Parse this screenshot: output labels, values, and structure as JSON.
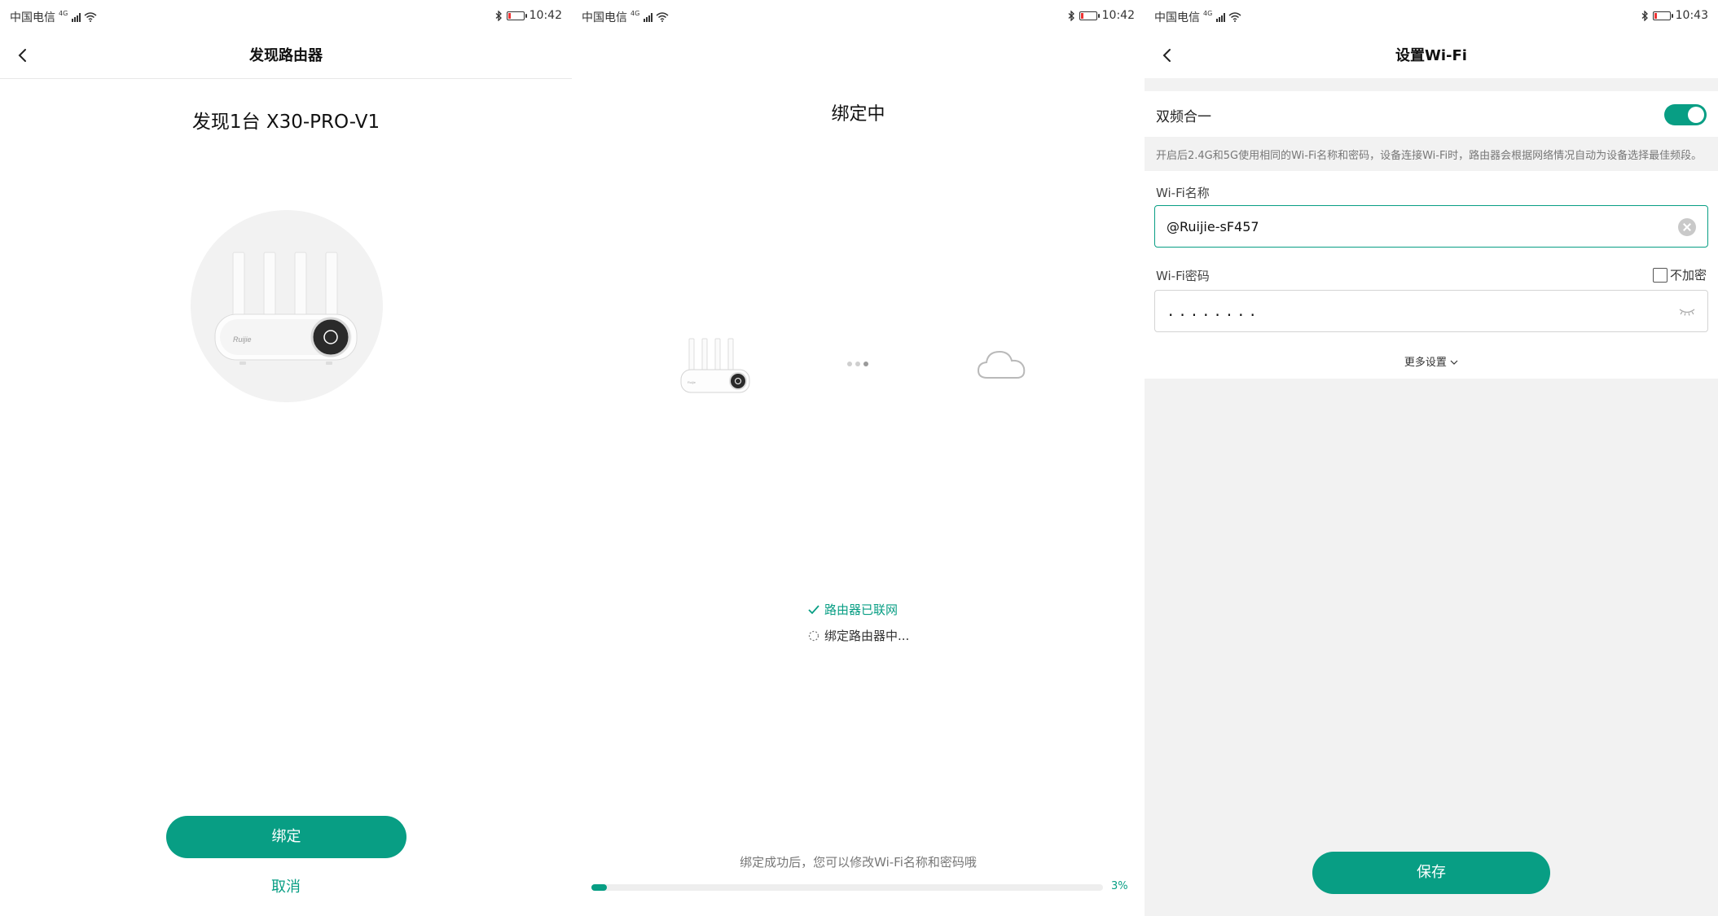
{
  "panels": [
    {
      "status": {
        "carrier": "中国电信",
        "network": "4G",
        "time": "10:42"
      },
      "nav_title": "发现路由器",
      "found_text": "发现1台 X30-PRO-V1",
      "bind_label": "绑定",
      "cancel_label": "取消"
    },
    {
      "status": {
        "carrier": "中国电信",
        "network": "4G",
        "time": "10:42"
      },
      "title": "绑定中",
      "steps": [
        {
          "label": "路由器已联网",
          "state": "done"
        },
        {
          "label": "绑定路由器中...",
          "state": "loading"
        }
      ],
      "hint": "绑定成功后，您可以修改Wi-Fi名称和密码哦",
      "progress_percent": 3,
      "progress_label": "3%"
    },
    {
      "status": {
        "carrier": "中国电信",
        "network": "4G",
        "time": "10:43"
      },
      "nav_title": "设置Wi-Fi",
      "dual_band_label": "双频合一",
      "dual_band_on": true,
      "dual_band_desc": "开启后2.4G和5G使用相同的Wi-Fi名称和密码，设备连接Wi-Fi时，路由器会根据网络情况自动为设备选择最佳频段。",
      "ssid_label": "Wi-Fi名称",
      "ssid_value": "@Ruijie-sF457",
      "password_label": "Wi-Fi密码",
      "no_password_label": "不加密",
      "password_masked": "........",
      "more_settings_label": "更多设置",
      "save_label": "保存"
    }
  ],
  "colors": {
    "accent": "#089e84",
    "panel3_bg": "#f2f2f2"
  },
  "icons": [
    "back-icon",
    "bluetooth-icon",
    "battery-icon",
    "wifi-icon",
    "signal-icon",
    "check-icon",
    "spinner-icon",
    "cloud-icon",
    "clear-icon",
    "eye-closed-icon",
    "chevron-down-icon"
  ]
}
